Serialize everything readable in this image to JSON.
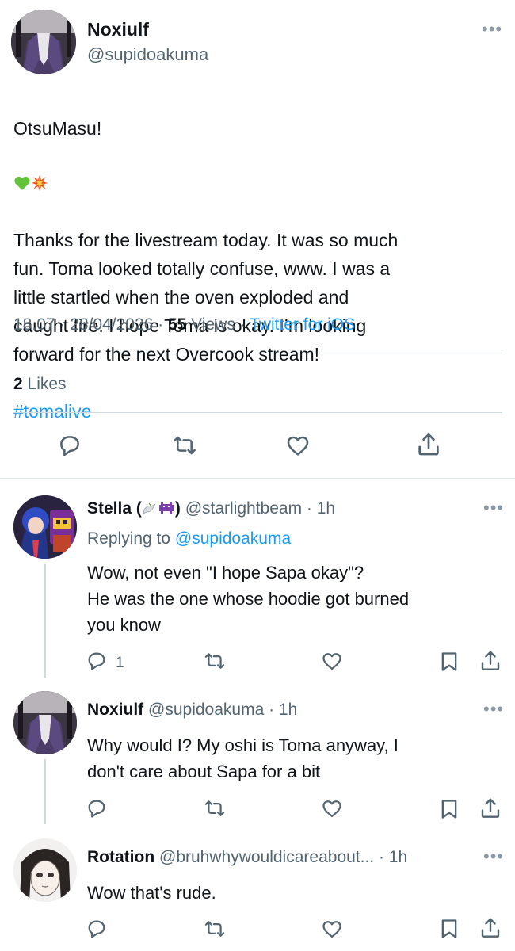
{
  "main_tweet": {
    "display_name": "Noxiulf",
    "handle": "@supidoakuma",
    "text_first": "OtsuMasu!",
    "text_body": "Thanks for the livestream today. It was so much\nfun. Toma looked totally confuse, www. I was a\nlittle startled when the oven exploded and\ncaught fire. I hope Toma is okay. I’m looking\nforward for the next Overcook stream!",
    "hashtag": "#tomalive",
    "time": "18.07 · 28/04/2026 · ",
    "views_count": "55",
    "views_label": " Views · ",
    "source": "Twitter for iOS",
    "likes_count": "2",
    "likes_label": " Likes"
  },
  "replies": [
    {
      "display_name": "Stella (",
      "name_suffix": ")",
      "handle_time": "@starlightbeam · 1h",
      "replying_label": "Replying to ",
      "replying_handle": "@supidoakuma",
      "text": "Wow, not even \"I hope Sapa okay\"?\nHe was the one whose hoodie got burned\nyou know",
      "reply_count": "1"
    },
    {
      "display_name": "Noxiulf",
      "handle_time": "@supidoakuma · 1h",
      "text": "Why would I? My oshi is Toma anyway, I\ndon't care about Sapa for a bit"
    },
    {
      "display_name": "Rotation",
      "handle_time": "@bruhwhywouldicareabout... · 1h",
      "text": "Wow that's rude."
    }
  ],
  "more_glyph": "•••",
  "colors": {
    "text": "#0f1419",
    "muted": "#536471",
    "accent": "#1d9bf0",
    "divider": "#cfd9de"
  }
}
